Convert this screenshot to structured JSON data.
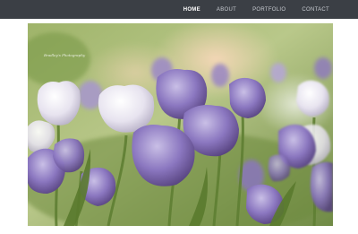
{
  "nav": {
    "items": [
      {
        "label": "HOME",
        "active": true
      },
      {
        "label": "ABOUT",
        "active": false
      },
      {
        "label": "PORTFOLIO",
        "active": false
      },
      {
        "label": "CONTACT",
        "active": false
      }
    ]
  },
  "hero": {
    "caption": "Bradley's Photography",
    "subject": "purple and white tulips",
    "colors": {
      "background_green": "#8fa85a",
      "tulip_purple": "#7d6ab0",
      "tulip_white": "#e8e4ee",
      "bokeh_pink": "#f2c9a8"
    }
  },
  "colors": {
    "navbar": "#3b3f45",
    "nav_text": "#c7cbd1",
    "nav_active": "#ffffff",
    "page_bg": "#ffffff"
  }
}
